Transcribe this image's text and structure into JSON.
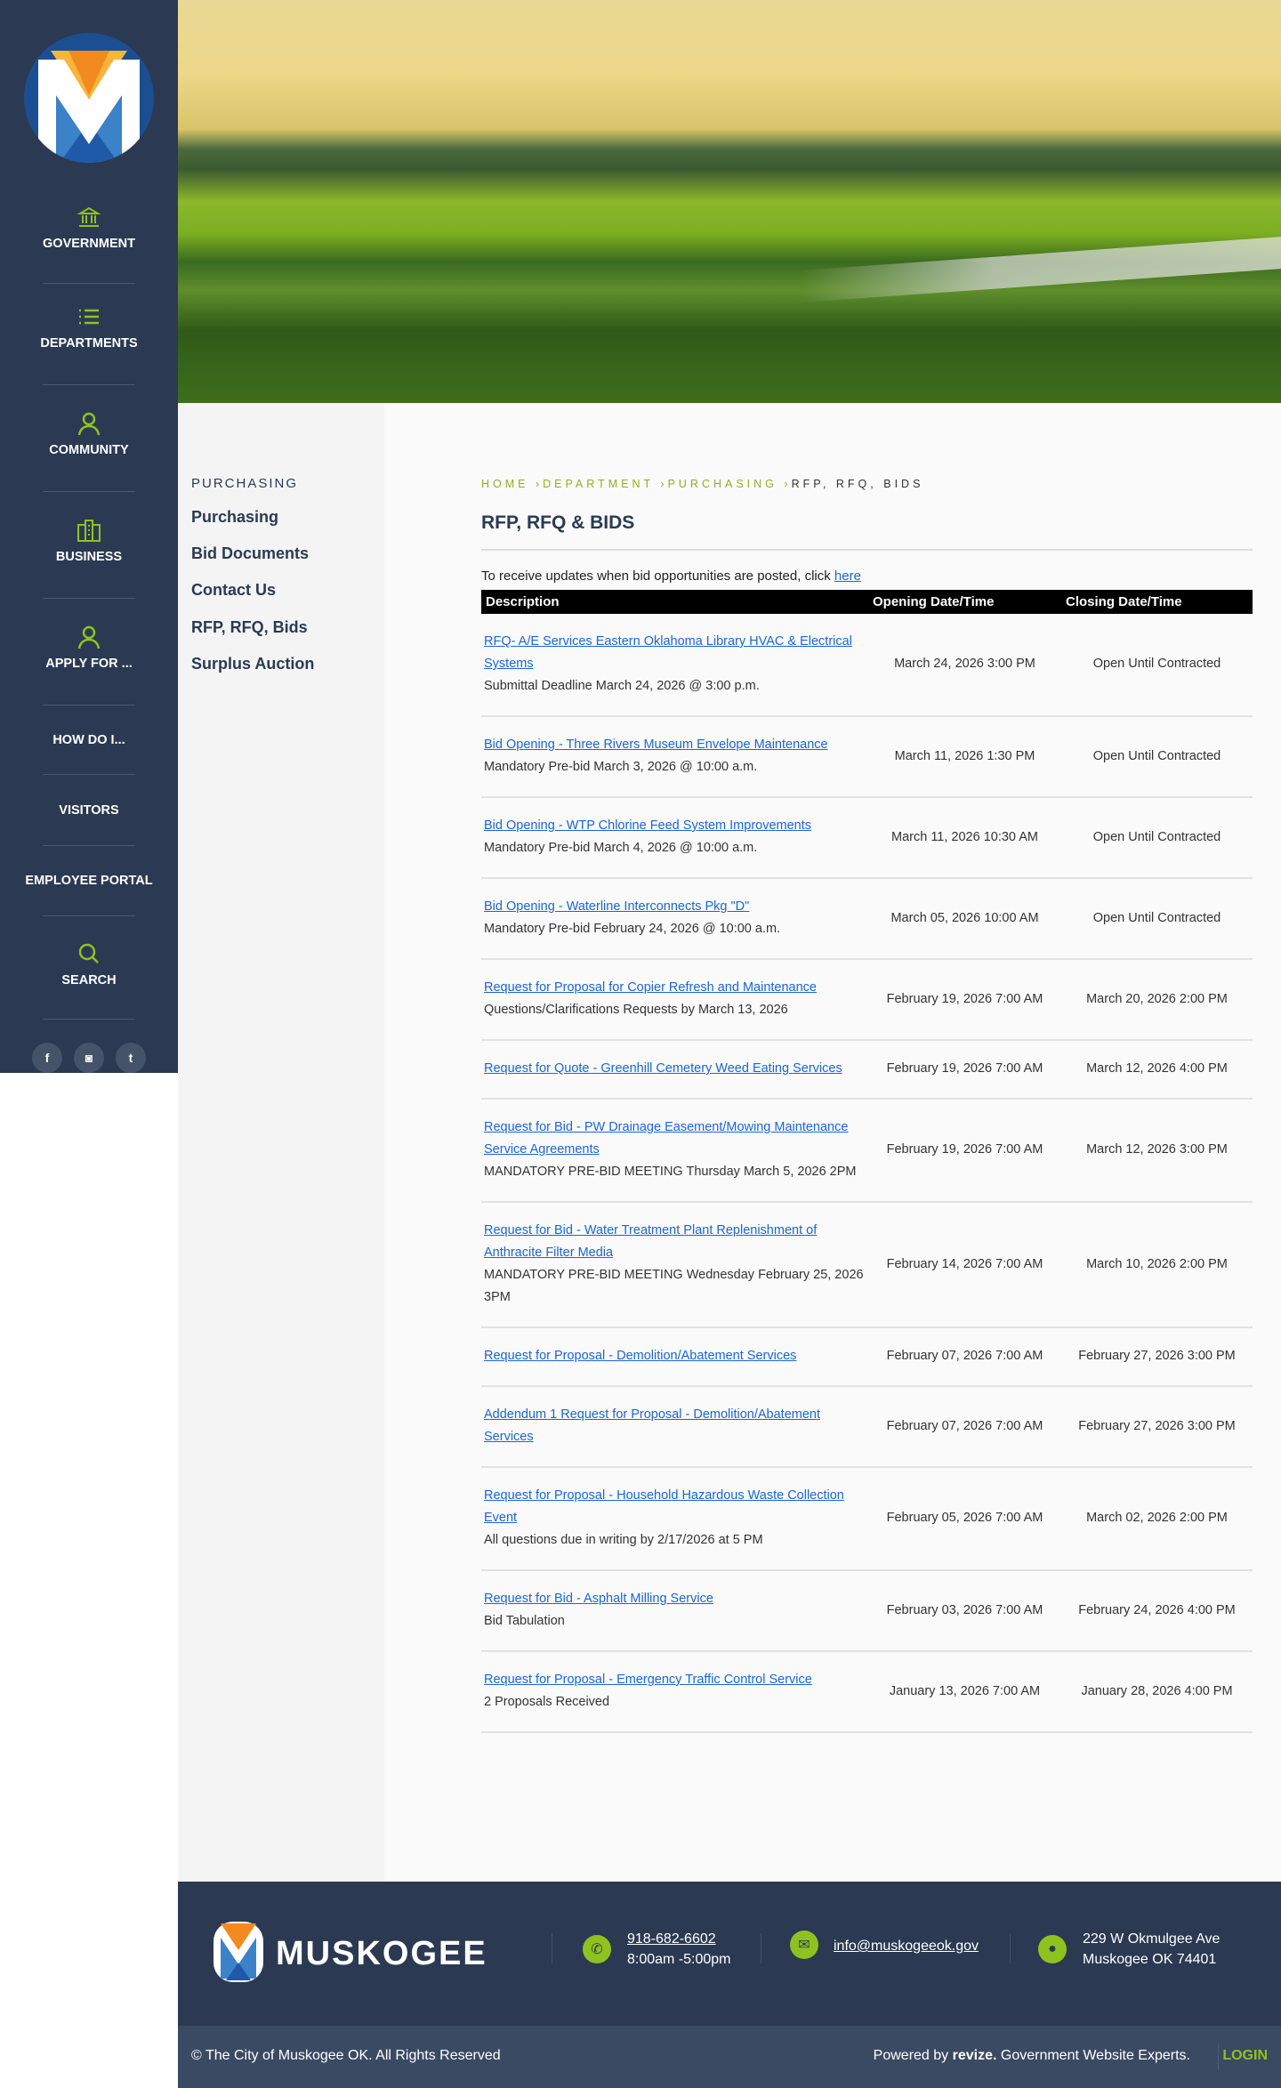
{
  "sidebar": {
    "items": [
      {
        "label": "GOVERNMENT",
        "icon": "government-building-icon"
      },
      {
        "label": "DEPARTMENTS",
        "icon": "list-icon"
      },
      {
        "label": "COMMUNITY",
        "icon": "person-icon"
      },
      {
        "label": "BUSINESS",
        "icon": "building-icon"
      },
      {
        "label": "APPLY FOR ...",
        "icon": "person-icon"
      },
      {
        "label": "HOW DO I..."
      },
      {
        "label": "VISITORS"
      },
      {
        "label": "EMPLOYEE PORTAL"
      },
      {
        "label": "SEARCH",
        "icon": "search-icon"
      }
    ],
    "social": [
      "f",
      "◙",
      "t"
    ]
  },
  "subnav": {
    "title": "PURCHASING",
    "links": [
      "Purchasing",
      "Bid Documents",
      "Contact Us",
      "RFP, RFQ, Bids",
      "Surplus Auction"
    ]
  },
  "breadcrumb": [
    "HOME",
    "DEPARTMENT",
    "PURCHASING",
    "RFP, RFQ, BIDS"
  ],
  "breadcrumb_sep": "›",
  "page_title": "RFP, RFQ & BIDS",
  "intro": {
    "text": "To receive updates when bid opportunities are posted, click ",
    "link": "here"
  },
  "table": {
    "headers": [
      "Description",
      "Opening Date/Time",
      "Closing Date/Time"
    ],
    "rows": [
      {
        "link": "RFQ- A/E Services Eastern Oklahoma Library HVAC & Electrical Systems",
        "note": "Submittal Deadline March 24, 2026 @ 3:00 p.m.",
        "open": "March 24, 2026 3:00 PM",
        "close": "Open Until Contracted"
      },
      {
        "link": "Bid Opening - Three Rivers Museum Envelope Maintenance",
        "note": "Mandatory Pre-bid March 3, 2026 @ 10:00 a.m.",
        "open": "March 11, 2026 1:30 PM",
        "close": "Open Until Contracted"
      },
      {
        "link": "Bid Opening - WTP Chlorine Feed System Improvements",
        "note": "Mandatory Pre-bid March 4, 2026 @ 10:00 a.m.",
        "open": "March 11, 2026 10:30 AM",
        "close": "Open Until Contracted"
      },
      {
        "link": "Bid Opening - Waterline Interconnects Pkg \"D\"",
        "note": "Mandatory Pre-bid February 24, 2026 @ 10:00 a.m.",
        "open": "March 05, 2026 10:00 AM",
        "close": "Open Until Contracted"
      },
      {
        "link": "Request for Proposal for Copier Refresh and Maintenance",
        "note": "Questions/Clarifications Requests by March 13, 2026",
        "open": "February 19, 2026 7:00 AM",
        "close": "March 20, 2026 2:00 PM"
      },
      {
        "link": "Request for Quote - Greenhill Cemetery Weed Eating Services",
        "note": null,
        "open": "February 19, 2026 7:00 AM",
        "close": "March 12, 2026 4:00 PM"
      },
      {
        "link": "Request for Bid - PW Drainage Easement/Mowing Maintenance Service Agreements",
        "note": "MANDATORY PRE-BID MEETING Thursday March 5, 2026 2PM",
        "open": "February 19, 2026 7:00 AM",
        "close": "March 12, 2026 3:00 PM"
      },
      {
        "link": "Request for Bid - Water Treatment Plant Replenishment of Anthracite Filter Media",
        "note": "MANDATORY PRE-BID MEETING Wednesday February 25, 2026 3PM",
        "open": "February 14, 2026 7:00 AM",
        "close": "March 10, 2026 2:00 PM"
      },
      {
        "link": "Request for Proposal - Demolition/Abatement Services",
        "note": null,
        "open": "February 07, 2026 7:00 AM",
        "close": "February 27, 2026 3:00 PM"
      },
      {
        "link": "Addendum 1 Request for Proposal - Demolition/Abatement Services",
        "note": null,
        "open": "February 07, 2026 7:00 AM",
        "close": "February 27, 2026 3:00 PM"
      },
      {
        "link": "Request for Proposal - Household Hazardous Waste Collection Event",
        "note": "All questions due in writing by 2/17/2026 at 5 PM",
        "open": "February 05, 2026 7:00 AM",
        "close": "March 02, 2026 2:00 PM"
      },
      {
        "link": "Request for Bid - Asphalt Milling Service",
        "note": "Bid Tabulation",
        "open": "February 03, 2026 7:00 AM",
        "close": "February 24, 2026 4:00 PM"
      },
      {
        "link": "Request for Proposal - Emergency Traffic Control Service",
        "note": "2 Proposals Received",
        "open": "January 13, 2026 7:00 AM",
        "close": "January 28, 2026 4:00 PM"
      }
    ]
  },
  "footer": {
    "brand": "MUSKOGEE",
    "phone": "918-682-6602",
    "hours": "8:00am -5:00pm",
    "email": "info@muskogeeok.gov",
    "address1": "229 W Okmulgee Ave",
    "address2": "Muskogee OK 74401",
    "copyright": "© The City of Muskogee OK. All Rights Reserved",
    "powered_prefix": "Powered by ",
    "powered_brand": "revize.",
    "powered_suffix": " Government Website Experts.",
    "login": "LOGIN"
  },
  "colors": {
    "navy": "#2b3a52",
    "accent": "#8fc21e",
    "link": "#1a66d6"
  }
}
